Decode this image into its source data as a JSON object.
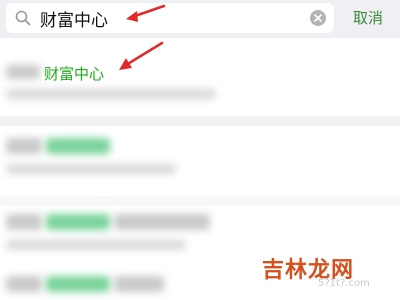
{
  "search": {
    "query": "财富中心",
    "cancel_label": "取消"
  },
  "results": {
    "first_keyword": "财富中心"
  },
  "watermark": {
    "brand": "吉林龙网",
    "url": "5?1t?.com"
  },
  "colors": {
    "keyword_green": "#1aad19",
    "cancel_green": "#3a8a3a",
    "annotation_red": "#e02b2b"
  }
}
